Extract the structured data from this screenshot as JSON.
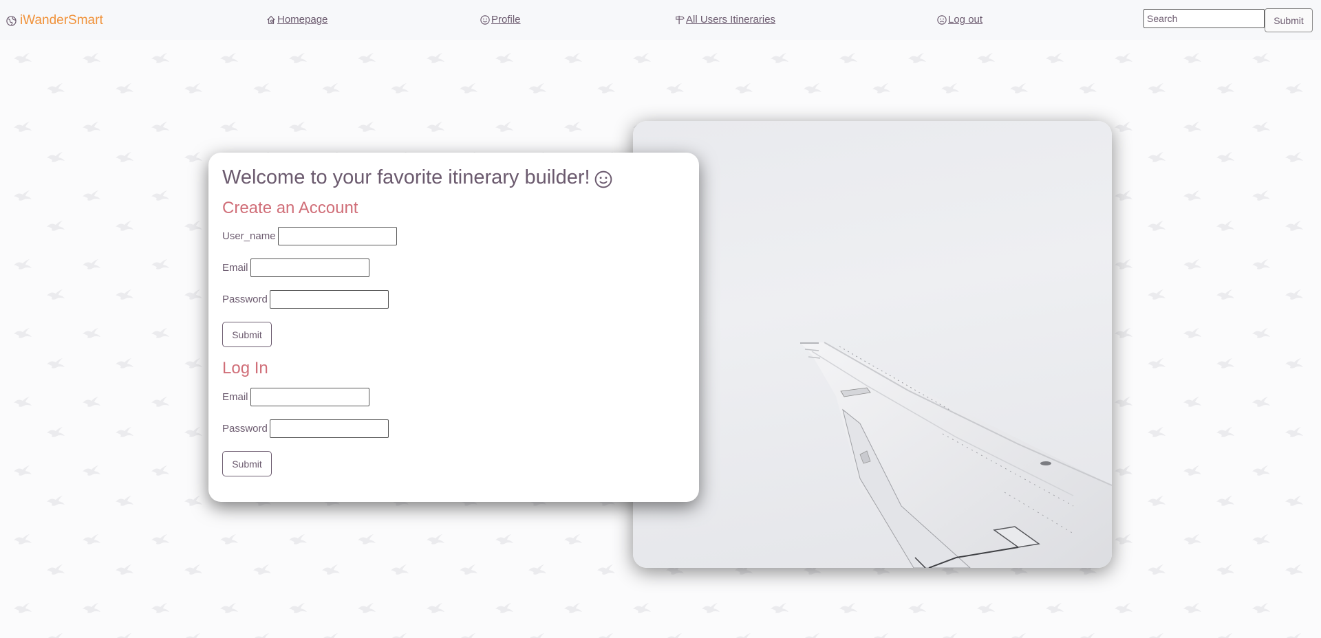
{
  "brand": {
    "name": "iWanderSmart",
    "icon": "globe-icon"
  },
  "nav": {
    "links": [
      {
        "label": " Homepage",
        "icon": "house-icon"
      },
      {
        "label": " Profile",
        "icon": "smiley-icon"
      },
      {
        "label": " All Users Itineraries",
        "icon": "signpost-icon"
      },
      {
        "label": " Log out",
        "icon": "frown-icon"
      }
    ],
    "search_placeholder": "Search",
    "submit_label": "Submit"
  },
  "main": {
    "welcome": "Welcome to your favorite itinerary builder!",
    "create_account": {
      "title": "Create an Account",
      "fields": [
        {
          "label": "User_name",
          "value": ""
        },
        {
          "label": "Email",
          "value": ""
        },
        {
          "label": "Password",
          "value": ""
        }
      ],
      "submit_label": "Submit"
    },
    "login": {
      "title": "Log In",
      "fields": [
        {
          "label": "Email",
          "value": ""
        },
        {
          "label": "Password",
          "value": ""
        }
      ],
      "submit_label": "Submit"
    }
  },
  "colors": {
    "brand": "#f0923a",
    "text": "#6b5a6e",
    "section_title": "#d06e78",
    "navbar_bg": "#f7f8fa"
  }
}
